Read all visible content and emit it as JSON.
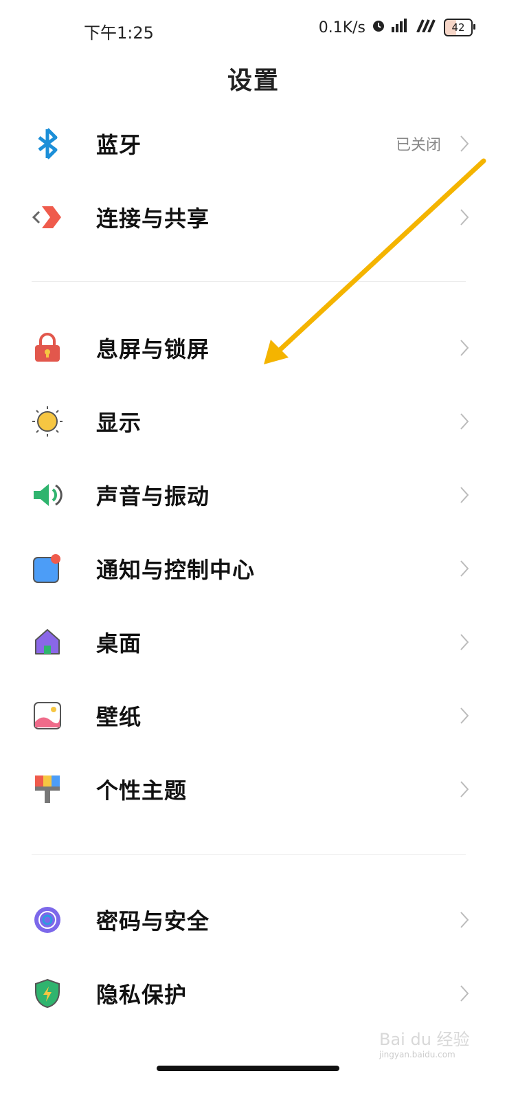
{
  "status": {
    "time": "下午1:25",
    "net_speed": "0.1K/s",
    "battery": "42"
  },
  "title": "设置",
  "rows": [
    {
      "label": "蓝牙",
      "value": "已关闭",
      "icon": "bluetooth-icon"
    },
    {
      "label": "连接与共享",
      "value": "",
      "icon": "connection-share-icon"
    },
    {
      "label": "息屏与锁屏",
      "value": "",
      "icon": "lock-icon"
    },
    {
      "label": "显示",
      "value": "",
      "icon": "sun-icon"
    },
    {
      "label": "声音与振动",
      "value": "",
      "icon": "speaker-icon"
    },
    {
      "label": "通知与控制中心",
      "value": "",
      "icon": "notification-icon"
    },
    {
      "label": "桌面",
      "value": "",
      "icon": "home-icon"
    },
    {
      "label": "壁纸",
      "value": "",
      "icon": "wallpaper-icon"
    },
    {
      "label": "个性主题",
      "value": "",
      "icon": "theme-brush-icon"
    },
    {
      "label": "密码与安全",
      "value": "",
      "icon": "fingerprint-icon"
    },
    {
      "label": "隐私保护",
      "value": "",
      "icon": "privacy-shield-icon"
    }
  ],
  "watermark": {
    "brand": "Bai du 经验",
    "url": "jingyan.baidu.com"
  },
  "colors": {
    "annotation_arrow": "#f4b400",
    "divider": "#ececec",
    "secondary_text": "#888888"
  }
}
